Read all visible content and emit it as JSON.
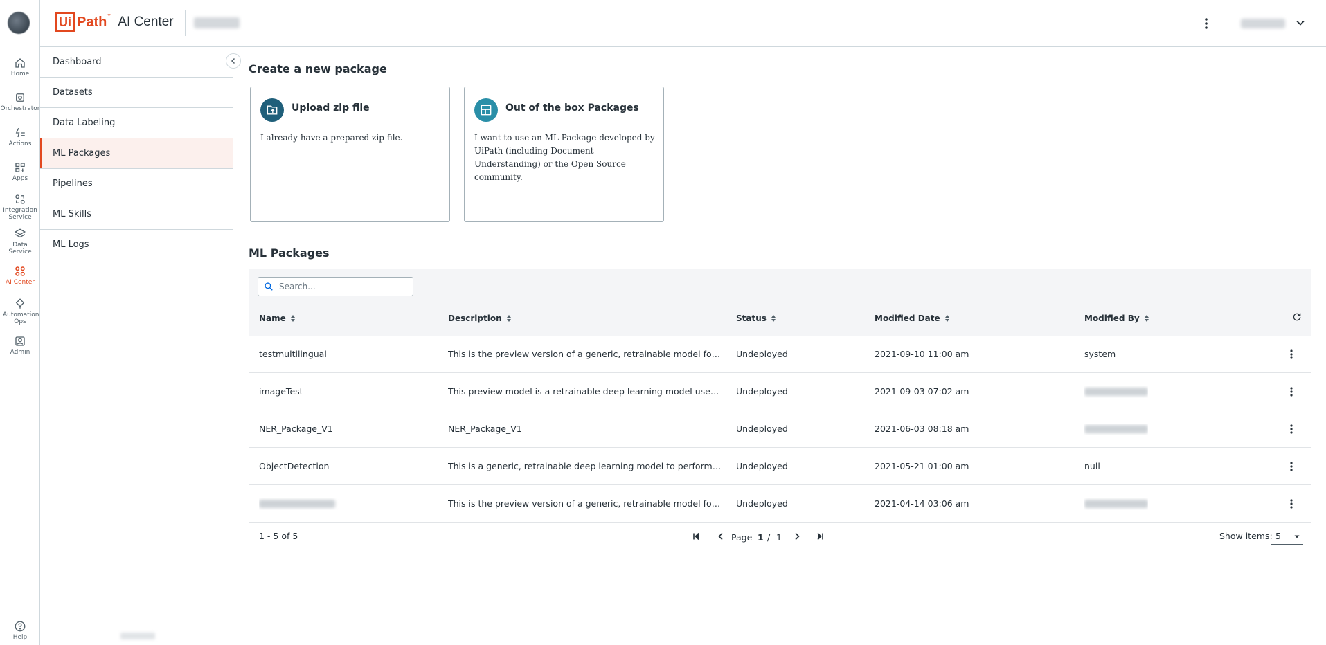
{
  "rail": {
    "items": [
      {
        "label": "Home"
      },
      {
        "label": "Orchestrator"
      },
      {
        "label": "Actions"
      },
      {
        "label": "Apps"
      },
      {
        "label": "Integration Service"
      },
      {
        "label": "Data Service"
      },
      {
        "label": "AI Center"
      },
      {
        "label": "Automation Ops"
      },
      {
        "label": "Admin"
      }
    ],
    "help": "Help",
    "accent": "#e2481f"
  },
  "header": {
    "logo_ui": "Ui",
    "logo_path": "Path",
    "logo_tm": "™",
    "product": "AI Center"
  },
  "sidenav": {
    "items": [
      {
        "label": "Dashboard"
      },
      {
        "label": "Datasets"
      },
      {
        "label": "Data Labeling"
      },
      {
        "label": "ML Packages"
      },
      {
        "label": "Pipelines"
      },
      {
        "label": "ML Skills"
      },
      {
        "label": "ML Logs"
      }
    ],
    "active": "ML Packages"
  },
  "create": {
    "title": "Create a new package",
    "cards": [
      {
        "title": "Upload zip file",
        "desc": "I already have a prepared zip file."
      },
      {
        "title": "Out of the box Packages",
        "desc": "I want to use an ML Package developed by UiPath (including Document Understanding) or the Open Source community."
      }
    ]
  },
  "packages": {
    "title": "ML Packages",
    "search_placeholder": "Search...",
    "columns": {
      "name": "Name",
      "description": "Description",
      "status": "Status",
      "modified_date": "Modified Date",
      "modified_by": "Modified By"
    },
    "rows": [
      {
        "name": "testmultilingual",
        "description": "This is the preview version of a generic, retrainable model for text classification",
        "status": "Undeployed",
        "modified_date": "2021-09-10 11:00 am",
        "modified_by": "system"
      },
      {
        "name": "imageTest",
        "description": "This preview model is a retrainable deep learning model used to classify images",
        "status": "Undeployed",
        "modified_date": "2021-09-03 07:02 am",
        "modified_by": ""
      },
      {
        "name": "NER_Package_V1",
        "description": "NER_Package_V1",
        "status": "Undeployed",
        "modified_date": "2021-06-03 08:18 am",
        "modified_by": ""
      },
      {
        "name": "ObjectDetection",
        "description": "This is a generic, retrainable deep learning model to perform Object Detection",
        "status": "Undeployed",
        "modified_date": "2021-05-21 01:00 am",
        "modified_by": "null"
      },
      {
        "name": "",
        "description": "This is the preview version of a generic, retrainable model for English text",
        "status": "Undeployed",
        "modified_date": "2021-04-14 03:06 am",
        "modified_by": ""
      }
    ],
    "pager": {
      "range": "1 - 5 of 5",
      "page_label": "Page",
      "current": "1",
      "separator": "/",
      "total": "1",
      "show_items_label": "Show items:",
      "show_items_value": "5"
    }
  }
}
